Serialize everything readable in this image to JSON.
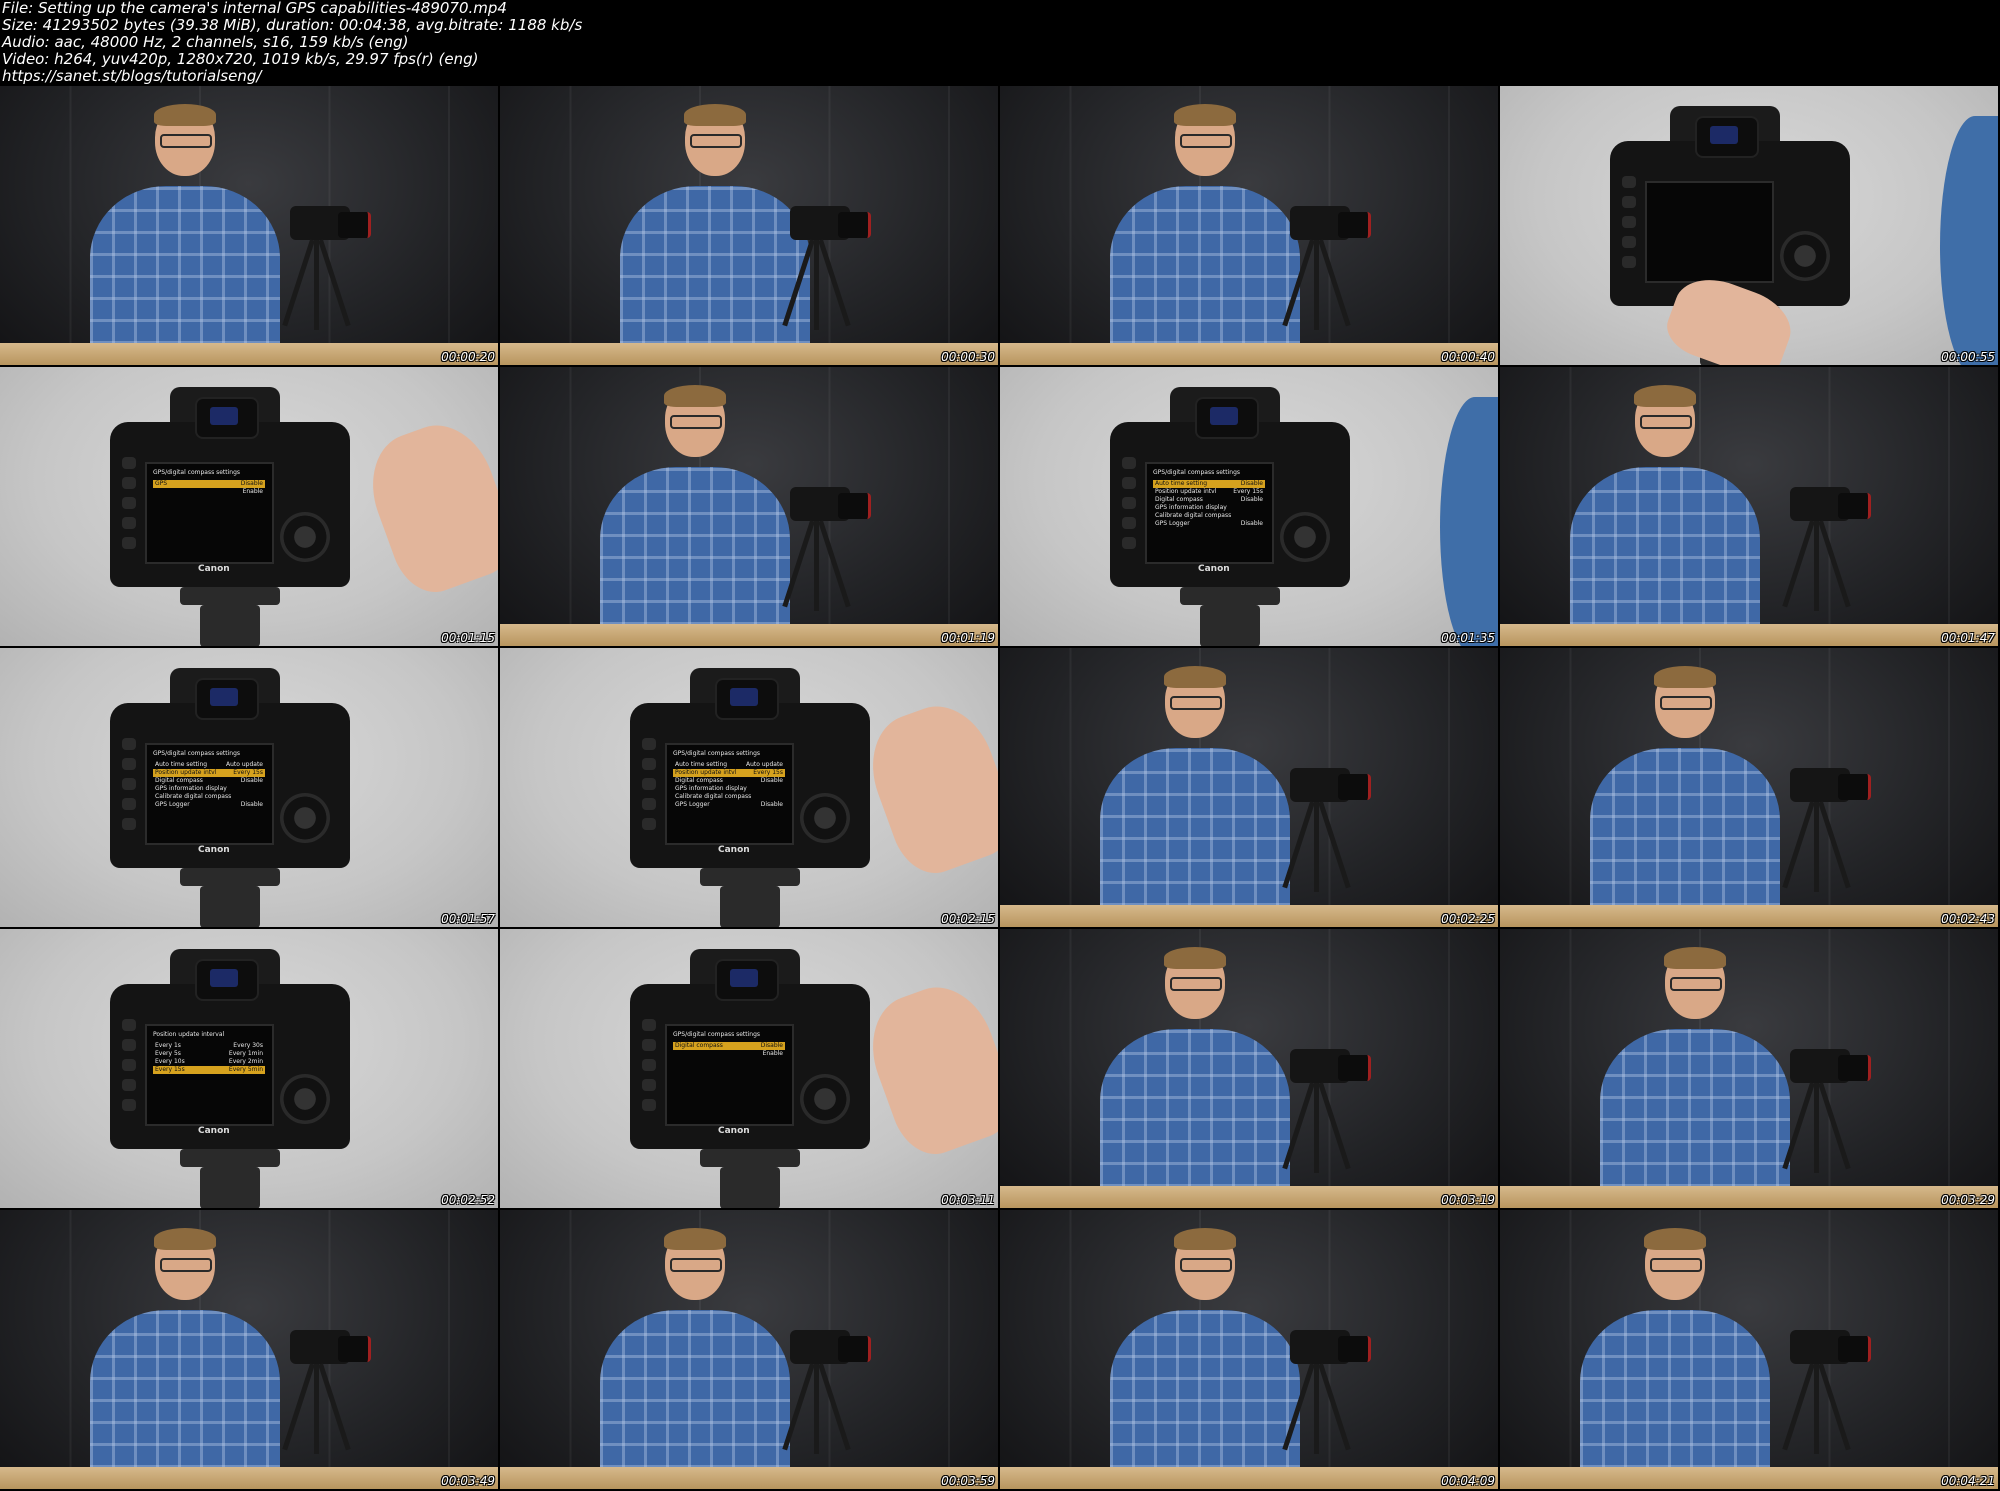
{
  "info": {
    "file": "File: Setting up the camera's internal GPS capabilities-489070.mp4",
    "size": "Size: 41293502 bytes (39.38 MiB), duration: 00:04:38, avg.bitrate: 1188 kb/s",
    "audio": "Audio: aac, 48000 Hz, 2 channels, s16, 159 kb/s (eng)",
    "video": "Video: h264, yuv420p, 1280x720, 1019 kb/s, 29.97 fps(r) (eng)",
    "url": "https://sanet.st/blogs/tutorialseng/"
  },
  "frames": [
    {
      "time": "00:00:20",
      "scene": "presenter"
    },
    {
      "time": "00:00:30",
      "scene": "presenter"
    },
    {
      "time": "00:00:40",
      "scene": "presenter"
    },
    {
      "time": "00:00:55",
      "scene": "camera-back"
    },
    {
      "time": "00:01:15",
      "scene": "camera-menu"
    },
    {
      "time": "00:01:19",
      "scene": "presenter"
    },
    {
      "time": "00:01:35",
      "scene": "camera-menu"
    },
    {
      "time": "00:01:47",
      "scene": "presenter"
    },
    {
      "time": "00:01:57",
      "scene": "camera-menu"
    },
    {
      "time": "00:02:15",
      "scene": "camera-menu"
    },
    {
      "time": "00:02:25",
      "scene": "presenter"
    },
    {
      "time": "00:02:43",
      "scene": "presenter"
    },
    {
      "time": "00:02:52",
      "scene": "camera-menu"
    },
    {
      "time": "00:03:11",
      "scene": "camera-menu"
    },
    {
      "time": "00:03:19",
      "scene": "presenter"
    },
    {
      "time": "00:03:29",
      "scene": "presenter"
    },
    {
      "time": "00:03:49",
      "scene": "presenter"
    },
    {
      "time": "00:03:59",
      "scene": "presenter"
    },
    {
      "time": "00:04:09",
      "scene": "presenter"
    },
    {
      "time": "00:04:21",
      "scene": "presenter"
    }
  ],
  "camera_screens": {
    "m1": {
      "title": "GPS/digital compass settings",
      "rows": [
        [
          "GPS",
          "Disable"
        ],
        [
          "",
          "Enable"
        ]
      ],
      "hl": 0
    },
    "m2": {
      "title": "GPS/digital compass settings",
      "rows": [
        [
          "Auto time setting",
          "Disable"
        ],
        [
          "Position update intvl",
          "Every 15s"
        ],
        [
          "Digital compass",
          "Disable"
        ],
        [
          "GPS information display",
          ""
        ],
        [
          "Calibrate digital compass",
          ""
        ],
        [
          "GPS Logger",
          "Disable"
        ]
      ],
      "hl": 0
    },
    "m3": {
      "title": "GPS/digital compass settings",
      "rows": [
        [
          "Auto time setting",
          "Auto update"
        ],
        [
          "Position update intvl",
          "Every 15s"
        ],
        [
          "Digital compass",
          "Disable"
        ],
        [
          "GPS information display",
          ""
        ],
        [
          "Calibrate digital compass",
          ""
        ],
        [
          "GPS Logger",
          "Disable"
        ]
      ],
      "hl": 1
    },
    "m4": {
      "title": "GPS/digital compass settings",
      "rows": [
        [
          "Auto time setting",
          "Auto update"
        ],
        [
          "Position update intvl",
          "Every 15s"
        ],
        [
          "Digital compass",
          "Disable"
        ],
        [
          "GPS information display",
          ""
        ],
        [
          "Calibrate digital compass",
          ""
        ],
        [
          "GPS Logger",
          "Disable"
        ]
      ],
      "hl": 1
    },
    "m5": {
      "title": "Position update interval",
      "rows": [
        [
          "Every 1s",
          "Every 30s"
        ],
        [
          "Every 5s",
          "Every 1min"
        ],
        [
          "Every 10s",
          "Every 2min"
        ],
        [
          "Every 15s",
          "Every 5min"
        ]
      ],
      "hl": 3
    },
    "m6": {
      "title": "GPS/digital compass settings",
      "rows": [
        [
          "Digital compass",
          "Disable"
        ],
        [
          "",
          "Enable"
        ]
      ],
      "hl": 0
    },
    "brand": "Canon"
  }
}
